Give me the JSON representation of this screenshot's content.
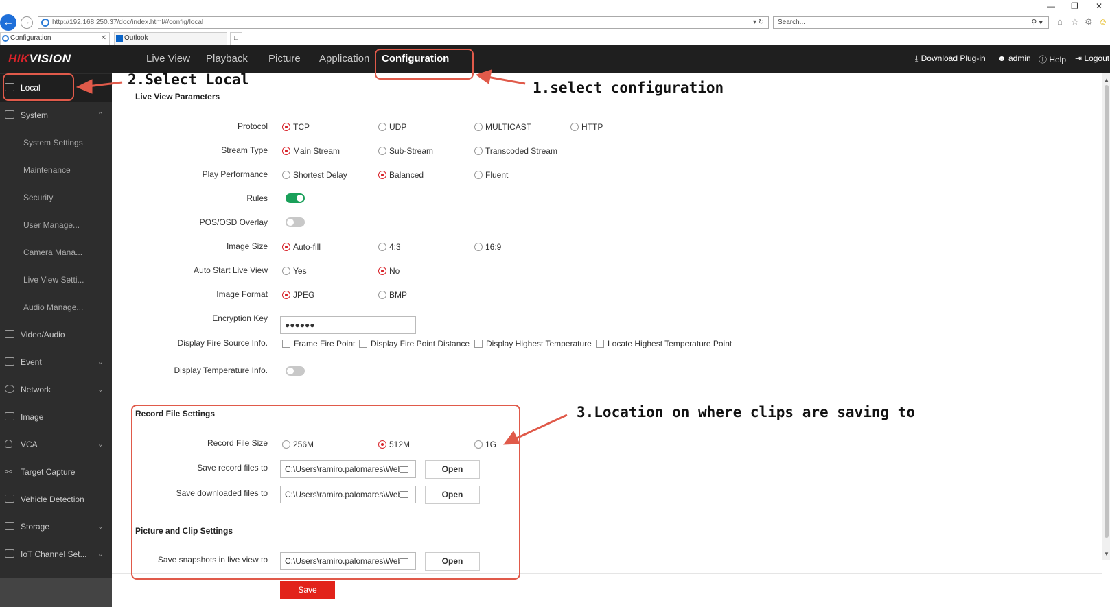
{
  "browser": {
    "url": "http://192.168.250.37/doc/index.html#/config/local",
    "search_placeholder": "Search...",
    "tabs": [
      {
        "label": "Configuration"
      },
      {
        "label": "Outlook"
      }
    ]
  },
  "app": {
    "logo_red": "HIK",
    "logo_white": "VISION",
    "nav": [
      "Live View",
      "Playback",
      "Picture",
      "Application",
      "Configuration"
    ],
    "header_right": {
      "download": "Download Plug-in",
      "user": "admin",
      "help": "Help",
      "logout": "Logout"
    }
  },
  "sidebar": {
    "items": [
      {
        "label": "Local",
        "icon": "monitor-icon"
      },
      {
        "label": "System",
        "icon": "system-icon"
      },
      {
        "label": "System Settings"
      },
      {
        "label": "Maintenance"
      },
      {
        "label": "Security"
      },
      {
        "label": "User Manage..."
      },
      {
        "label": "Camera Mana..."
      },
      {
        "label": "Live View Setti..."
      },
      {
        "label": "Audio Manage..."
      },
      {
        "label": "Video/Audio",
        "icon": "video-icon"
      },
      {
        "label": "Event",
        "icon": "event-icon"
      },
      {
        "label": "Network",
        "icon": "globe-icon"
      },
      {
        "label": "Image",
        "icon": "image-icon"
      },
      {
        "label": "VCA",
        "icon": "bulb-icon"
      },
      {
        "label": "Target Capture",
        "icon": "person-icon"
      },
      {
        "label": "Vehicle Detection",
        "icon": "car-icon"
      },
      {
        "label": "Storage",
        "icon": "storage-icon"
      },
      {
        "label": "IoT Channel Set...",
        "icon": "iot-icon"
      }
    ]
  },
  "live_view": {
    "title": "Live View Parameters",
    "protocol": {
      "label": "Protocol",
      "options": [
        "TCP",
        "UDP",
        "MULTICAST",
        "HTTP"
      ],
      "selected": "TCP"
    },
    "stream_type": {
      "label": "Stream Type",
      "options": [
        "Main Stream",
        "Sub-Stream",
        "Transcoded Stream"
      ],
      "selected": "Main Stream"
    },
    "play_performance": {
      "label": "Play Performance",
      "options": [
        "Shortest Delay",
        "Balanced",
        "Fluent"
      ],
      "selected": "Balanced"
    },
    "rules": {
      "label": "Rules",
      "on": true
    },
    "pos_osd": {
      "label": "POS/OSD Overlay",
      "on": false
    },
    "image_size": {
      "label": "Image Size",
      "options": [
        "Auto-fill",
        "4:3",
        "16:9"
      ],
      "selected": "Auto-fill"
    },
    "auto_start": {
      "label": "Auto Start Live View",
      "options": [
        "Yes",
        "No"
      ],
      "selected": "No"
    },
    "image_format": {
      "label": "Image Format",
      "options": [
        "JPEG",
        "BMP"
      ],
      "selected": "JPEG"
    },
    "encryption_key": {
      "label": "Encryption Key",
      "value": "●●●●●●"
    },
    "fire_source": {
      "label": "Display Fire Source Info.",
      "options": [
        "Frame Fire Point",
        "Display Fire Point Distance",
        "Display Highest Temperature",
        "Locate Highest Temperature Point"
      ]
    },
    "temp_info": {
      "label": "Display Temperature Info.",
      "on": false
    }
  },
  "record": {
    "title": "Record File Settings",
    "file_size": {
      "label": "Record File Size",
      "options": [
        "256M",
        "512M",
        "1G"
      ],
      "selected": "512M"
    },
    "save_record": {
      "label": "Save record files to",
      "value": "C:\\Users\\ramiro.palomares\\Web",
      "button": "Open"
    },
    "save_download": {
      "label": "Save downloaded files to",
      "value": "C:\\Users\\ramiro.palomares\\Web",
      "button": "Open"
    }
  },
  "picture": {
    "title": "Picture and Clip Settings",
    "save_snapshots": {
      "label": "Save snapshots in live view to",
      "value": "C:\\Users\\ramiro.palomares\\Web",
      "button": "Open"
    }
  },
  "save_label": "Save",
  "annotations": {
    "step1": "1.select configuration",
    "step2": "2.Select Local",
    "step3": "3.Location on where clips are saving to",
    "color": "#e05a4a"
  }
}
